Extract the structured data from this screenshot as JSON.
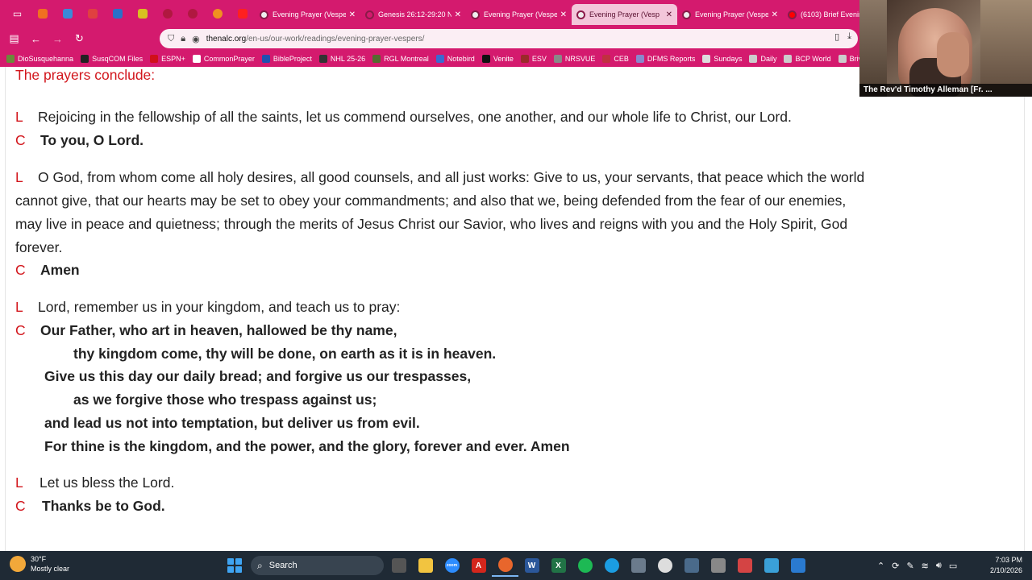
{
  "browser": {
    "tabs": [
      {
        "title": "Evening Prayer (Vesper",
        "active": false,
        "favicon_color": "#eeeeee"
      },
      {
        "title": "Genesis 26:12-29:20 N",
        "active": false,
        "favicon_color": "#d41a6e"
      },
      {
        "title": "Evening Prayer (Vesper",
        "active": false,
        "favicon_color": "#eeeeee"
      },
      {
        "title": "Evening Prayer (Vesp",
        "active": true,
        "favicon_color": "#eeeeee"
      },
      {
        "title": "Evening Prayer (Vesper",
        "active": false,
        "favicon_color": "#eeeeee"
      },
      {
        "title": "(6103) Brief Evening P",
        "active": false,
        "favicon_color": "#ff0000"
      }
    ],
    "url_host": "thenalc.org",
    "url_path": "/en-us/our-work/readings/evening-prayer-vespers/",
    "bookmarks": [
      {
        "label": "DioSusquehanna",
        "color": "#6a8a3a"
      },
      {
        "label": "SusqCOM Files",
        "color": "#222222"
      },
      {
        "label": "ESPN+",
        "color": "#d0101a"
      },
      {
        "label": "CommonPrayer",
        "color": "#ffffff"
      },
      {
        "label": "BibleProject",
        "color": "#2050b0"
      },
      {
        "label": "NHL 25-26",
        "color": "#333333"
      },
      {
        "label": "RGL Montreal",
        "color": "#556b2f"
      },
      {
        "label": "Notebird",
        "color": "#3a6ad0"
      },
      {
        "label": "Venite",
        "color": "#111111"
      },
      {
        "label": "ESV",
        "color": "#9a2a2a"
      },
      {
        "label": "NRSVUE",
        "color": "#888888"
      },
      {
        "label": "CEB",
        "color": "#c03040"
      },
      {
        "label": "DFMS Reports",
        "color": "#8888cc"
      },
      {
        "label": "Sundays",
        "color": "#dddddd"
      },
      {
        "label": "Daily",
        "color": "#cccccc"
      },
      {
        "label": "BCP World",
        "color": "#cccccc"
      },
      {
        "label": "Brivo",
        "color": "#cccccc"
      }
    ]
  },
  "webcam": {
    "name": "The Rev'd Timothy Alleman [Fr. ..."
  },
  "page": {
    "heading": "The prayers conclude:",
    "blocks": [
      {
        "mark": "L",
        "text": "Rejoicing in the fellowship of all the saints, let us commend ourselves, one another, and our whole life to Christ, our Lord."
      },
      {
        "mark": "C",
        "text": "To you, O Lord."
      },
      {
        "mark": "L",
        "text": "O God, from whom come all holy desires, all good counsels, and all just works: Give to us, your servants, that peace which the world"
      },
      {
        "text": "cannot give, that our hearts may be set to obey your commandments; and also that we, being defended from the fear of our enemies,"
      },
      {
        "text": "may live in peace and quietness; through the merits of Jesus Christ our Savior, who lives and reigns with you and the Holy Spirit, God"
      },
      {
        "text": "forever."
      },
      {
        "mark": "C",
        "text": "Amen"
      },
      {
        "mark": "L",
        "text": "Lord, remember us in your kingdom, and teach us to pray:"
      },
      {
        "mark": "C",
        "text": "Our Father, who art in heaven, hallowed be thy name,"
      },
      {
        "text": "thy kingdom come, thy will be done, on earth as it is in heaven."
      },
      {
        "text": "Give us this day our daily bread; and forgive us our trespasses,"
      },
      {
        "text": "as we forgive those who trespass against us;"
      },
      {
        "text": "and lead us not into temptation, but deliver us from evil."
      },
      {
        "text": "For thine is the kingdom, and the power, and the glory, forever and ever. Amen"
      },
      {
        "mark": "L",
        "text": "Let us bless the Lord."
      },
      {
        "mark": "C",
        "text": "Thanks be to God."
      }
    ]
  },
  "taskbar": {
    "temperature": "30°F",
    "weather": "Mostly clear",
    "search_label": "Search",
    "time": "7:03 PM",
    "date": "2/10/2026",
    "apps": [
      {
        "name": "task-view",
        "color": "#555555",
        "glyph": ""
      },
      {
        "name": "file-explorer",
        "color": "#f2c440",
        "glyph": ""
      },
      {
        "name": "zoom",
        "color": "#2d8cff",
        "glyph": "zoom"
      },
      {
        "name": "acrobat",
        "color": "#d4261c",
        "glyph": "A"
      },
      {
        "name": "firefox",
        "color": "#e8662c",
        "glyph": ""
      },
      {
        "name": "word",
        "color": "#2b579a",
        "glyph": "W"
      },
      {
        "name": "excel",
        "color": "#217346",
        "glyph": "X"
      },
      {
        "name": "spotify",
        "color": "#1db954",
        "glyph": ""
      },
      {
        "name": "edge",
        "color": "#1b9de2",
        "glyph": ""
      },
      {
        "name": "calculator",
        "color": "#6b7b8c",
        "glyph": ""
      },
      {
        "name": "clock",
        "color": "#dddddd",
        "glyph": ""
      },
      {
        "name": "monitor",
        "color": "#4a6a8a",
        "glyph": ""
      },
      {
        "name": "settings",
        "color": "#888888",
        "glyph": ""
      },
      {
        "name": "app-red",
        "color": "#d44444",
        "glyph": ""
      },
      {
        "name": "notepad",
        "color": "#3aa0d8",
        "glyph": ""
      },
      {
        "name": "app-blue",
        "color": "#2a7ad0",
        "glyph": ""
      }
    ]
  }
}
